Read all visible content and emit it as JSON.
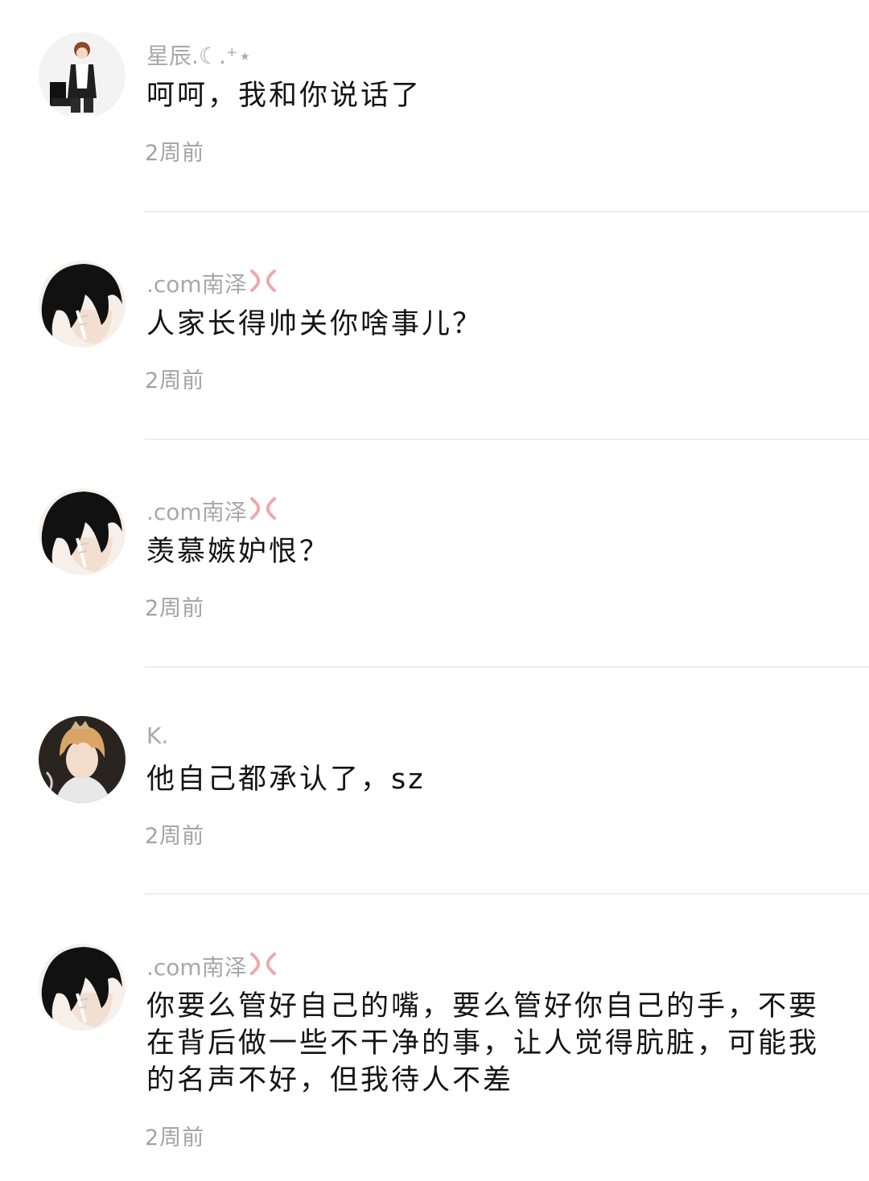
{
  "comments": [
    {
      "username": "星辰.☾.⁺⋆",
      "text": "呵呵，我和你说话了",
      "time": "2周前",
      "avatar": "avatar-boy-standing"
    },
    {
      "username": ".com南泽",
      "text": "人家长得帅关你啥事儿？",
      "time": "2周前",
      "avatar": "avatar-dark-hair",
      "badge": "anger-icon"
    },
    {
      "username": ".com南泽",
      "text": "羡慕嫉妒恨？",
      "time": "2周前",
      "avatar": "avatar-dark-hair",
      "badge": "anger-icon"
    },
    {
      "username": "K.",
      "text": "他自己都承认了，sz",
      "time": "2周前",
      "avatar": "avatar-blond-crown"
    },
    {
      "username": ".com南泽",
      "text": "你要么管好自己的嘴，要么管好你自己的手，不要在背后做一些不干净的事，让人觉得肮脏，可能我的名声不好，但我待人不差",
      "time": "2周前",
      "avatar": "avatar-dark-hair",
      "badge": "anger-icon"
    }
  ],
  "colors": {
    "username": "#a8a8a8",
    "text": "#141414",
    "time": "#a3a3a3",
    "divider": "#ececec",
    "anger": "#f0a8a8"
  }
}
